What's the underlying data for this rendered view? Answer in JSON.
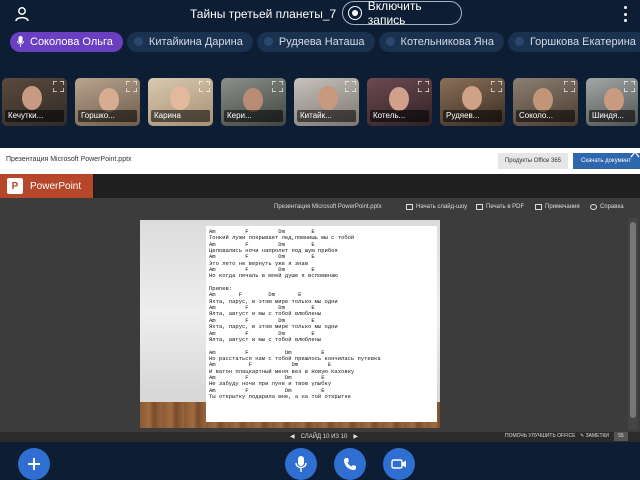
{
  "header": {
    "title": "Тайны третьей планеты_7",
    "record_label": "Включить запись"
  },
  "participants": [
    {
      "name": "Соколова Ольга",
      "active": true
    },
    {
      "name": "Китайкина Дарина"
    },
    {
      "name": "Рудяева Наташа"
    },
    {
      "name": "Котельникова Яна"
    },
    {
      "name": "Горшкова Екатерина"
    }
  ],
  "tiles": [
    {
      "name": "Кечутки..."
    },
    {
      "name": "Горшко..."
    },
    {
      "name": "Карина"
    },
    {
      "name": "Кери..."
    },
    {
      "name": "Китайк..."
    },
    {
      "name": "Котель..."
    },
    {
      "name": "Рудяев..."
    },
    {
      "name": "Соколо..."
    },
    {
      "name": "Шиндя..."
    }
  ],
  "office": {
    "doc_name": "Презентация Microsoft PowerPoint.pptx",
    "products_btn": "Продукты Office 365",
    "download_btn": "Скачать документ",
    "brand": "PowerPoint",
    "logo_letter": "P"
  },
  "viewer_toolbar": {
    "doc_title": "Презентация Microsoft PowerPoint.pptx",
    "start_show": "Начать слайд-шоу",
    "print_pdf": "Печать в PDF",
    "notes": "Примечания",
    "help": "Справка"
  },
  "slide_lines": [
    {
      "t": "chord",
      "text": "Am         F         Dm        E"
    },
    {
      "t": "lyric",
      "text": "Тонкий лужи покрывает лед,помнишь мы с тобой"
    },
    {
      "t": "chord",
      "text": "Am         F         Dm        E"
    },
    {
      "t": "lyric",
      "text": "Целовались ночи напролет под шум прибоя"
    },
    {
      "t": "chord",
      "text": "Am         F         Dm        E"
    },
    {
      "t": "lyric",
      "text": "Это лето не вернуть уже я знаю"
    },
    {
      "t": "chord",
      "text": "Am         F         Dm        E"
    },
    {
      "t": "lyric",
      "text": "Но когда печаль в моей душе я вспоминаю"
    },
    {
      "t": "spacer",
      "text": ""
    },
    {
      "t": "lyric",
      "text": "Припев:"
    },
    {
      "t": "chord",
      "text": "Am       F        Dm       E"
    },
    {
      "t": "lyric",
      "text": "Яхта, парус, в этом мире только мы одни"
    },
    {
      "t": "chord",
      "text": "Am         F         Dm        E"
    },
    {
      "t": "lyric",
      "text": "Ялта, август и мы с тобой влюблены"
    },
    {
      "t": "chord",
      "text": "Am         F         Dm        E"
    },
    {
      "t": "lyric",
      "text": "Яхта, парус, в этом мире только мы одни"
    },
    {
      "t": "chord",
      "text": "Am         F         Dm        E"
    },
    {
      "t": "lyric",
      "text": "Ялта, август и мы с тобой влюблены"
    },
    {
      "t": "spacer",
      "text": ""
    },
    {
      "t": "chord",
      "text": "Am         F           Dm         E"
    },
    {
      "t": "lyric",
      "text": "Но расстаться нам с тобой пришлось кончилась путевка"
    },
    {
      "t": "chord",
      "text": "Am          F            Dm         E"
    },
    {
      "t": "lyric",
      "text": "И вагон плацкартный меня вез в Новую Каховку"
    },
    {
      "t": "chord",
      "text": "Am         F           Dm         E"
    },
    {
      "t": "lyric",
      "text": "Не забуду ночи при луне и твою улыбку"
    },
    {
      "t": "chord",
      "text": "Am         F           Dm         E"
    },
    {
      "t": "lyric",
      "text": "Ты открытку подарила мне, а на той открытке"
    }
  ],
  "status": {
    "slide_info": "СЛАЙД 10 ИЗ 10",
    "help_improve": "ПОМОЧЬ УЛУЧШИТЬ OFFICE",
    "notes": "ЗАМЕТКИ",
    "zoom": "55"
  }
}
